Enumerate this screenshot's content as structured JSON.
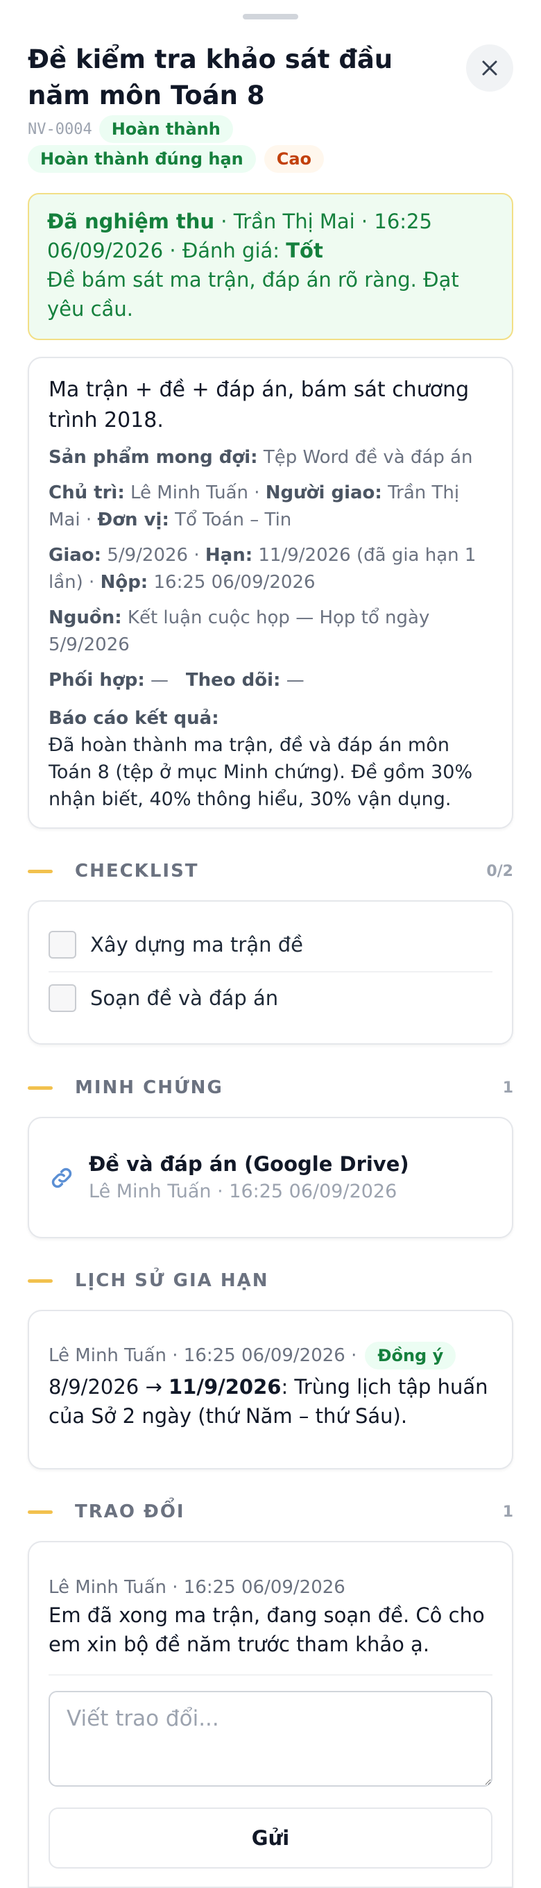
{
  "task": {
    "title": "Đề kiểm tra khảo sát đầu năm môn Toán 8",
    "code": "NV-0004",
    "status": "Hoàn thành",
    "timeliness": "Hoàn thành đúng hạn",
    "priority": "Cao"
  },
  "acceptance": {
    "label": "Đã nghiệm thu",
    "sep1": " · ",
    "by": "Trần Thị Mai",
    "sep2": " · ",
    "time": "16:25 06/09/2026",
    "sep3": " · ",
    "rating_label": "Đánh giá:",
    "rating": "Tốt",
    "comment": "Đề bám sát ma trận, đáp án rõ ràng. Đạt yêu cầu."
  },
  "details": {
    "description": "Ma trận + đề + đáp án, bám sát chương trình 2018.",
    "expected_label": "Sản phẩm mong đợi:",
    "expected": "Tệp Word đề và đáp án",
    "owner_label": "Chủ trì:",
    "owner": "Lê Minh Tuấn",
    "assigner_label": "Người giao:",
    "assigner": "Trần Thị Mai",
    "unit_label": "Đơn vị:",
    "unit": "Tổ Toán – Tin",
    "assigned_label": "Giao:",
    "assigned": "5/9/2026",
    "due_label": "Hạn:",
    "due": "11/9/2026 (đã gia hạn 1 lần)",
    "submitted_label": "Nộp:",
    "submitted": "16:25 06/09/2026",
    "source_label": "Nguồn:",
    "source": "Kết luận cuộc họp — Họp tổ ngày 5/9/2026",
    "coop_label": "Phối hợp:",
    "coop": "—",
    "watch_label": "Theo dõi:",
    "watch": "—",
    "report_label": "Báo cáo kết quả:",
    "report": "Đã hoàn thành ma trận, đề và đáp án môn Toán 8 (tệp ở mục Minh chứng). Đề gồm 30% nhận biết, 40% thông hiểu, 30% vận dụng."
  },
  "checklist": {
    "title": "CHECKLIST",
    "count": "0/2",
    "items": [
      {
        "label": "Xây dựng ma trận đề"
      },
      {
        "label": "Soạn đề và đáp án"
      }
    ]
  },
  "evidence": {
    "title": "MINH CHỨNG",
    "count": "1",
    "items": [
      {
        "title": "Đề và đáp án (Google Drive)",
        "meta": "Lê Minh Tuấn · 16:25 06/09/2026"
      }
    ]
  },
  "extensions": {
    "title": "LỊCH SỬ GIA HẠN",
    "items": [
      {
        "meta": "Lê Minh Tuấn · 16:25 06/09/2026 ·",
        "status": "Đồng ý",
        "from": "8/9/2026",
        "arrow": " → ",
        "to": "11/9/2026",
        "reason": ": Trùng lịch tập huấn của Sở 2 ngày (thứ Năm – thứ Sáu)."
      }
    ]
  },
  "discussion": {
    "title": "TRAO ĐỔI",
    "count": "1",
    "messages": [
      {
        "meta": "Lê Minh Tuấn · 16:25 06/09/2026",
        "text": "Em đã xong ma trận, đang soạn đề. Cô cho em xin bộ đề năm trước tham khảo ạ."
      }
    ],
    "placeholder": "Viết trao đổi...",
    "send_label": "Gửi"
  },
  "colors": {
    "success": "#15803d",
    "success_bg": "#ecfdf3",
    "warning": "#c2410c",
    "warning_bg": "#fff7ed",
    "section_accent": "#f2c14e"
  },
  "icons": {
    "close": "close-icon",
    "link": "link-icon"
  }
}
